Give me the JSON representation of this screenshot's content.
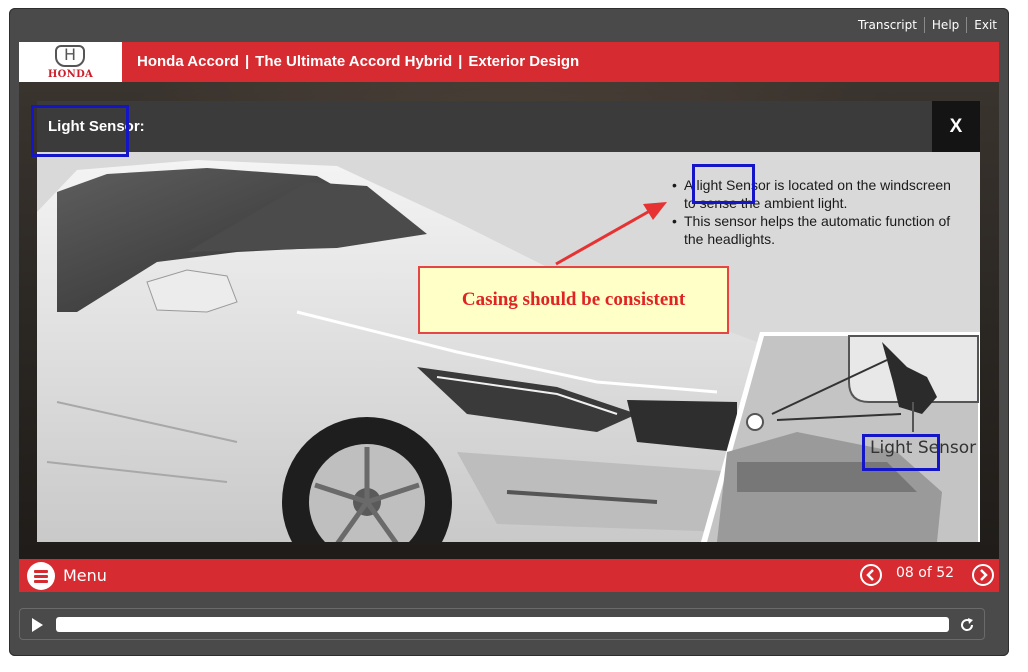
{
  "top_links": [
    "Transcript",
    "Help",
    "Exit"
  ],
  "brand": {
    "logo_text": "HONDA"
  },
  "header": {
    "course": "Honda Accord",
    "module": "The Ultimate Accord Hybrid",
    "topic": "Exterior Design",
    "separator": "|"
  },
  "modal": {
    "title": "Light Sensor:",
    "close_label": "X",
    "bullets": [
      "A light Sensor is located on the windscreen to sense the ambient light.",
      "This sensor helps the automatic function of the headlights."
    ],
    "inset_label": "Light Sensor"
  },
  "annotation": {
    "callout_text": "Casing should be consistent",
    "box_color": "#1515c8",
    "callout_border": "#e64545",
    "callout_text_color": "#e02424"
  },
  "navbar": {
    "menu_label": "Menu",
    "page_indicator": "08 of 52"
  },
  "player": {
    "progress": 0
  },
  "colors": {
    "brand_red": "#d62b30",
    "frame": "#4a4a4a",
    "modal_bar": "#3b3b3b",
    "close_bg": "#141414"
  },
  "icons": [
    "honda-logo",
    "menu-list-icon",
    "chevron-left-icon",
    "chevron-right-icon",
    "play-icon",
    "replay-icon",
    "close-icon"
  ]
}
